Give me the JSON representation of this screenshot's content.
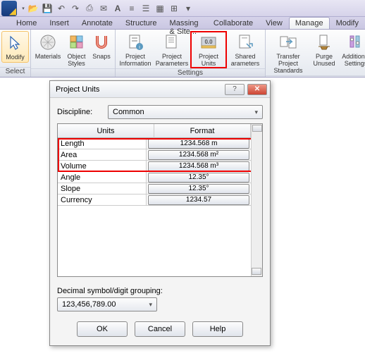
{
  "qat": [
    "open",
    "save",
    "undo",
    "redo",
    "text",
    "link",
    "bold",
    "align",
    "list",
    "table",
    "grid"
  ],
  "tabs": [
    "Home",
    "Insert",
    "Annotate",
    "Structure",
    "Massing & Site...",
    "Collaborate",
    "View",
    "Manage",
    "Modify"
  ],
  "active_tab": "Manage",
  "ribbon": {
    "groups": [
      {
        "label": "Select",
        "items": [
          {
            "name": "Modify"
          }
        ]
      },
      {
        "label": "",
        "items": [
          {
            "name": "Materials"
          },
          {
            "name": "Object\nStyles"
          },
          {
            "name": "Snaps"
          }
        ]
      },
      {
        "label": "Settings",
        "items": [
          {
            "name": "Project\nInformation"
          },
          {
            "name": "Project\nParameters"
          },
          {
            "name": "Project\nUnits",
            "hl": true
          },
          {
            "name": "Shared\narameters"
          }
        ]
      },
      {
        "label": "",
        "items": [
          {
            "name": "Transfer\nProject Standards"
          },
          {
            "name": "Purge\nUnused"
          },
          {
            "name": "Additional\nSettings"
          }
        ]
      }
    ]
  },
  "dialog": {
    "title": "Project Units",
    "discipline_label": "Discipline:",
    "discipline_value": "Common",
    "headers": [
      "Units",
      "Format"
    ],
    "rows": [
      {
        "unit": "Length",
        "fmt": "1234.568 m"
      },
      {
        "unit": "Area",
        "fmt": "1234.568 m²"
      },
      {
        "unit": "Volume",
        "fmt": "1234.568 m³"
      },
      {
        "unit": "Angle",
        "fmt": "12.35°"
      },
      {
        "unit": "Slope",
        "fmt": "12.35°"
      },
      {
        "unit": "Currency",
        "fmt": "1234.57"
      }
    ],
    "decimal_label": "Decimal symbol/digit grouping:",
    "decimal_value": "123,456,789.00",
    "buttons": {
      "ok": "OK",
      "cancel": "Cancel",
      "help": "Help"
    }
  }
}
